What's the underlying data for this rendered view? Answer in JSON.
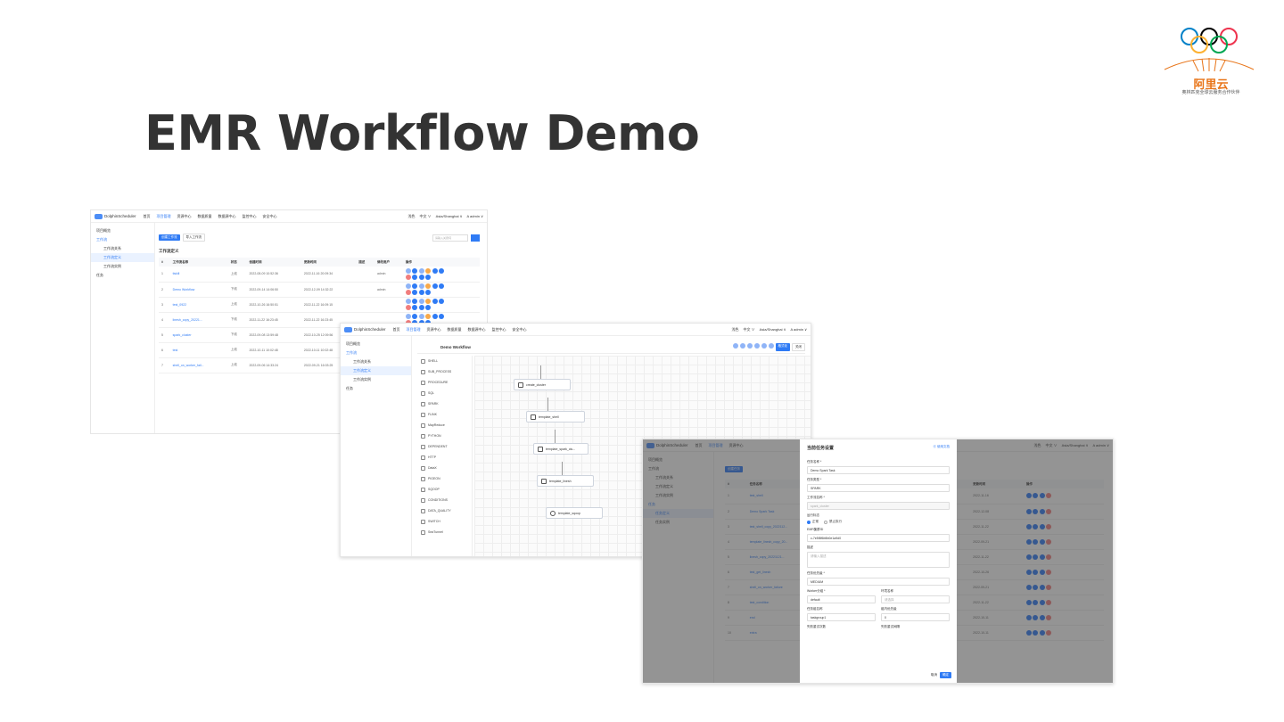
{
  "slide": {
    "title": "EMR Workflow Demo"
  },
  "logo": {
    "brand": "阿里云",
    "slogan": "奥林匹克全球云服务合作伙伴"
  },
  "app": {
    "logo_text": "DolphinScheduler",
    "nav": [
      "首页",
      "项目管理",
      "资源中心",
      "数据质量",
      "数据源中心",
      "监控中心",
      "安全中心"
    ],
    "active_nav": "项目管理",
    "right": [
      "浅色",
      "中文 ∨",
      "Asia/Shanghai ∨",
      "A admin ∨"
    ]
  },
  "window1": {
    "sidebar": [
      "项目概览",
      "工作流",
      "工作流关系",
      "工作流定义",
      "工作流实例",
      "任务"
    ],
    "buttons": {
      "create": "创建工作流",
      "import": "导入工作流"
    },
    "search_placeholder": "请输入关键词",
    "section_title": "工作流定义",
    "columns": [
      "#",
      "工作流名称",
      "状态",
      "创建时间",
      "更新时间",
      "描述",
      "修改用户",
      "操作"
    ],
    "rows": [
      {
        "id": "1",
        "name": "tiskill",
        "status": "上线",
        "created": "2022-08-09 10:52:36",
        "updated": "2022-11-16 20:09:34",
        "user": "admin"
      },
      {
        "id": "2",
        "name": "Demo Workflow",
        "status": "下线",
        "created": "2022-09-14 14:06:50",
        "updated": "2022-12-09 14:32:22",
        "user": "admin"
      },
      {
        "id": "3",
        "name": "test_0922",
        "status": "上线",
        "created": "2022-10-26 16:50:51",
        "updated": "2022-11-22 16:09:15",
        "user": ""
      },
      {
        "id": "4",
        "name": "linesh_copy_20221...",
        "status": "下线",
        "created": "2022-11-22 16:23:45",
        "updated": "2022-11-22 16:23:45",
        "user": ""
      },
      {
        "id": "5",
        "name": "spark_cluster",
        "status": "下线",
        "created": "2022-09-08 13:59:48",
        "updated": "2022-10-25 12:09:56",
        "user": ""
      },
      {
        "id": "6",
        "name": "test",
        "status": "上线",
        "created": "2022-10-11 10:02:48",
        "updated": "2022-10-11 10:02:48",
        "user": ""
      },
      {
        "id": "7",
        "name": "shell_on_worker_fail...",
        "status": "上线",
        "created": "2022-09-06 14:33:24",
        "updated": "2022-09-21 16:03:25",
        "user": ""
      }
    ]
  },
  "window2": {
    "sidebar": [
      "项目概览",
      "工作流",
      "工作流关系",
      "工作流定义",
      "工作流实例",
      "任务"
    ],
    "workflow_title": "Demo Workflow",
    "toolbar_buttons": {
      "format": "格式化",
      "close": "关闭"
    },
    "tools": [
      "SHELL",
      "SUB_PROCESS",
      "PROCEDURE",
      "SQL",
      "SPARK",
      "FLINK",
      "MapReduce",
      "PYTHON",
      "DEPENDENT",
      "HTTP",
      "DataX",
      "PIGEON",
      "SQOOP",
      "CONDITIONS",
      "DATA_QUALITY",
      "SWITCH",
      "SeaTunnel"
    ],
    "nodes": [
      "create_cluster",
      "template_shell",
      "template_spark_clu...",
      "template_linesh",
      "template_sqoop"
    ]
  },
  "window3": {
    "sidebar": [
      "项目概览",
      "工作流",
      "工作流关系",
      "工作流定义",
      "工作流实例",
      "任务",
      "任务定义",
      "任务实例"
    ],
    "create_button": "创建任务",
    "columns": [
      "#",
      "任务名称",
      "工作",
      "创建时间",
      "更新时间",
      "操作"
    ],
    "rows": [
      {
        "id": "1",
        "name": "test_shell",
        "created": "2022-11-16 20:09:34",
        "updated": "2022-11-16"
      },
      {
        "id": "2",
        "name": "Demo Spark Task",
        "created": "2022-08-08 13:59:48",
        "updated": "2022-12-08"
      },
      {
        "id": "3",
        "name": "test_shell_copy_2022112...",
        "created": "2022-11-22 16:03:48",
        "updated": "2022-11-22"
      },
      {
        "id": "4",
        "name": "template_linesh_copy_20...",
        "created": "2022-09-21 16:03:06",
        "updated": "2022-09-21"
      },
      {
        "id": "5",
        "name": "linesh_copy_20221121...",
        "created": "2022-11-22 16:03:48",
        "updated": "2022-11-22"
      },
      {
        "id": "6",
        "name": "test_get_linesh",
        "created": "2022-10-26 10:52:51",
        "updated": "2022-10-26"
      },
      {
        "id": "7",
        "name": "shell_on_worker_failure",
        "created": "2022-09-06 14:33:24",
        "updated": "2022-09-21"
      },
      {
        "id": "8",
        "name": "test_condition",
        "created": "2022-11-03 20:19:54",
        "updated": "2022-11-22"
      },
      {
        "id": "9",
        "name": "end",
        "created": "2022-10-11 10:02:48",
        "updated": "2022-10-11"
      },
      {
        "id": "10",
        "name": "extra",
        "created": "2022-10-11 10:02:48",
        "updated": "2022-10-11"
      }
    ],
    "modal": {
      "title": "当前任务设置",
      "help_link": "⓪ 使用文档",
      "task_name_label": "任务名称 *",
      "task_name_value": "Demo Spark Task",
      "task_type_label": "任务类型 *",
      "task_type_value": "SPARK",
      "workflow_name_label": "工作流名称 *",
      "workflow_name_value": "spark_cluster",
      "run_flag_label": "运行标志",
      "run_flag_normal": "正常",
      "run_flag_forbid": "禁止执行",
      "emr_label": "EMR集群ID",
      "emr_value": "c-7e5f8f6b5b0e1a9d0",
      "desc_label": "描述",
      "desc_placeholder": "请输入描述",
      "priority_label": "任务优先级 *",
      "priority_value": "MEDIUM",
      "worker_label": "Worker分组 *",
      "worker_value": "default",
      "env_label": "环境名称",
      "env_placeholder": "请选择",
      "group_label": "任务组名称",
      "group_value": "taskgroup1",
      "group_priority_label": "组内优先级",
      "group_priority_value": "0",
      "retry_label": "失败重试次数",
      "retry_interval_label": "失败重试间隔",
      "cancel": "取消",
      "confirm": "确定"
    }
  }
}
